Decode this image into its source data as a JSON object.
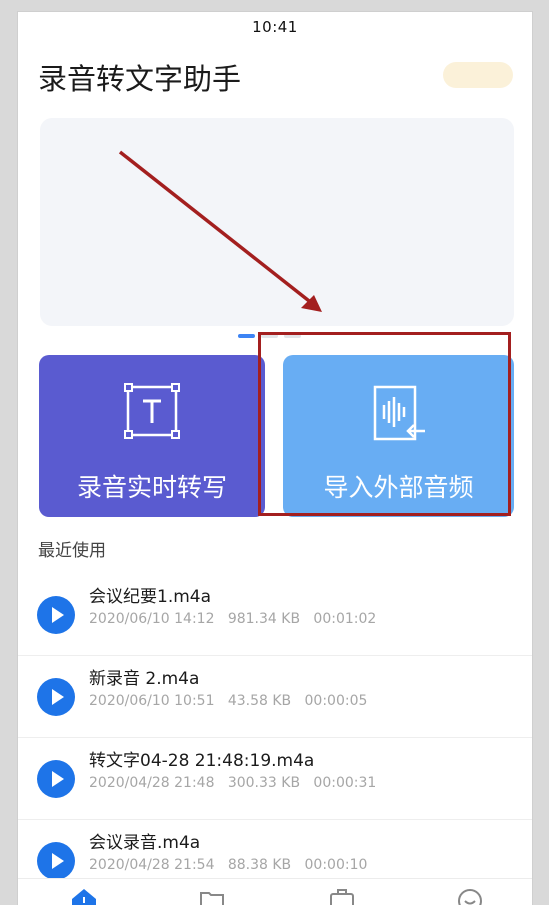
{
  "status_bar": {
    "time": "10:41"
  },
  "header": {
    "title": "录音转文字助手"
  },
  "cards": {
    "realtime_label": "录音实时转写",
    "import_label": "导入外部音频",
    "realtime_icon": "text-frame-icon",
    "import_icon": "audio-file-import-icon"
  },
  "recent": {
    "title": "最近使用",
    "items": [
      {
        "name": "会议纪要1.m4a",
        "meta": "2020/06/10 14:12   981.34 KB   00:01:02"
      },
      {
        "name": "新录音 2.m4a",
        "meta": "2020/06/10 10:51   43.58 KB   00:00:05"
      },
      {
        "name": "转文字04-28 21:48:19.m4a",
        "meta": "2020/04/28 21:48   300.33 KB   00:00:31"
      },
      {
        "name": "会议录音.m4a",
        "meta": "2020/04/28 21:54   88.38 KB   00:00:10"
      }
    ]
  },
  "tabs": [
    "home-icon",
    "folder-icon",
    "briefcase-icon",
    "smiley-icon"
  ],
  "colors": {
    "accent_blue": "#1e74e8",
    "card_purple": "#5a5bd0",
    "card_light_blue": "#68adf3",
    "annotation_red": "#a31f1f"
  }
}
